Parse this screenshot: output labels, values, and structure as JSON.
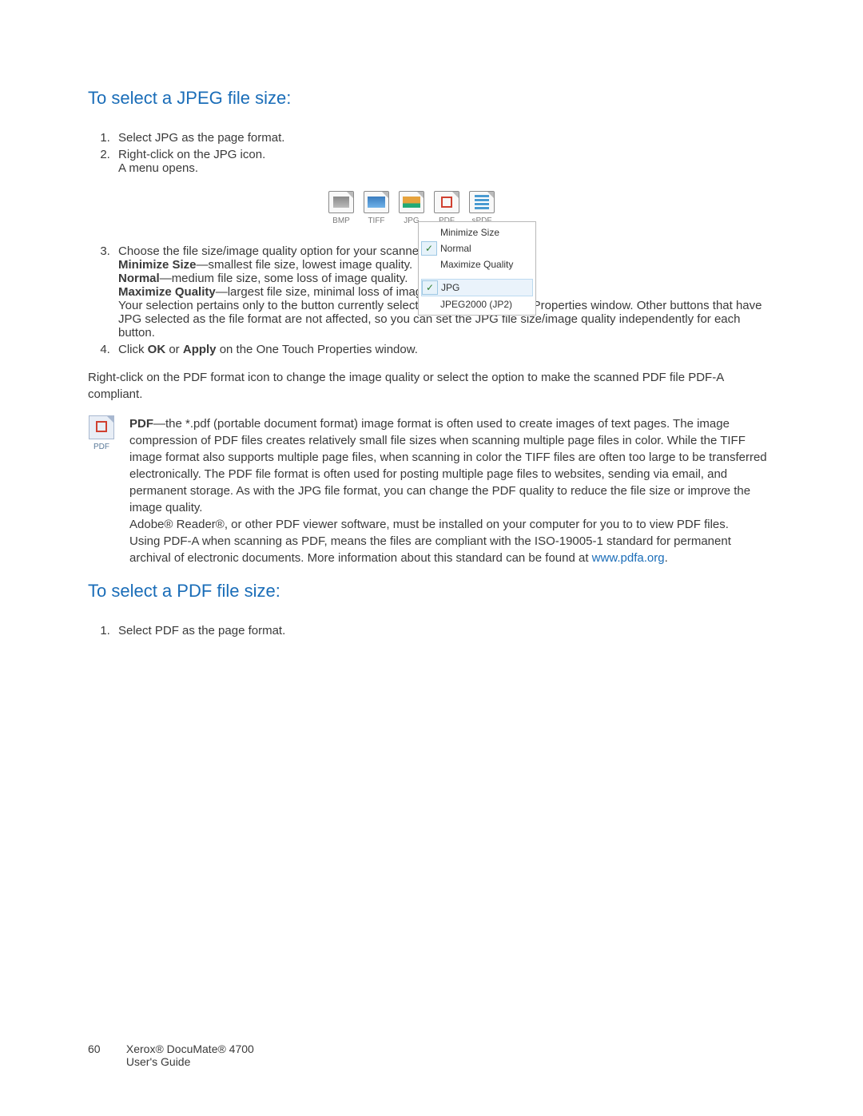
{
  "h_jpeg": "To select a JPEG file size:",
  "jpeg_steps": {
    "s1": "Select JPG as the page format.",
    "s2": "Right-click on the JPG icon.",
    "s2_sub": "A menu opens.",
    "s3": "Choose the file size/image quality option for your scanned images.",
    "s3_min_b": "Minimize Size",
    "s3_min_t": "—smallest file size, lowest image quality.",
    "s3_norm_b": "Normal",
    "s3_norm_t": "—medium file size, some loss of image quality.",
    "s3_max_b": "Maximize Quality",
    "s3_max_t": "—largest file size, minimal loss of image quality.",
    "s3_note": "Your selection pertains only to the button currently selected on the One Touch Properties window. Other buttons that have JPG selected as the file format are not affected, so you can set the JPG file size/image quality independently for each button.",
    "s4_pre": "Click ",
    "s4_ok": "OK",
    "s4_mid": " or ",
    "s4_apply": "Apply",
    "s4_post": " on the One Touch Properties window."
  },
  "figure": {
    "formats": [
      "BMP",
      "TIFF",
      "JPG",
      "PDF",
      "sPDF"
    ],
    "menu": {
      "minimize": "Minimize Size",
      "normal": "Normal",
      "maximize": "Maximize Quality",
      "jpg": "JPG",
      "jp2": "JPEG2000 (JP2)"
    }
  },
  "pdf_intro": "Right-click on the PDF format icon to change the image quality or select the option to make the scanned PDF file PDF-A compliant.",
  "pdf_block": {
    "label": "PDF",
    "bold": "PDF",
    "p1": "—the *.pdf (portable document format) image format is often used to create images of text pages. The image compression of PDF files creates relatively small file sizes when scanning multiple page files in color. While the TIFF image format also supports multiple page files, when scanning in color the TIFF files are often too large to be transferred electronically. The PDF file format is often used for posting multiple page files to websites, sending via email, and permanent storage. As with the JPG file format, you can change the PDF quality to reduce the file size or improve the image quality.",
    "p2": "Adobe® Reader®, or other PDF viewer software, must be installed on your computer for you to to view PDF files.",
    "p3_pre": "Using PDF-A when scanning as PDF, means the files are compliant with the ISO-19005-1 standard for permanent archival of electronic documents. More information about this standard can be found at ",
    "p3_link": "www.pdfa.org",
    "p3_post": "."
  },
  "h_pdf": "To select a PDF file size:",
  "pdf_steps": {
    "s1": "Select PDF as the page format."
  },
  "footer": {
    "page": "60",
    "line1": "Xerox® DocuMate® 4700",
    "line2": "User's Guide"
  }
}
